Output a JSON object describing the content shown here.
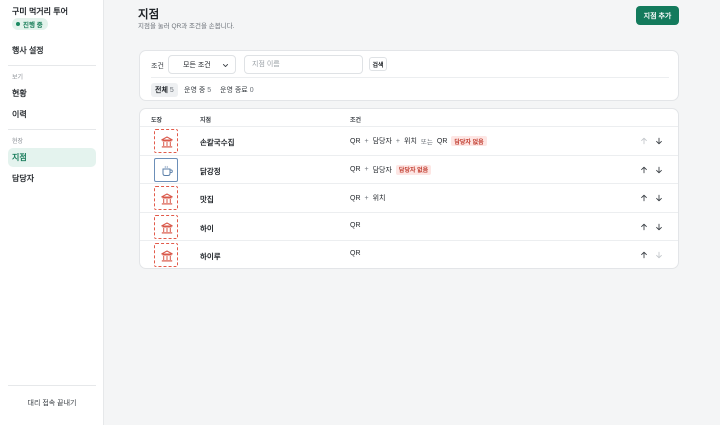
{
  "sidebar": {
    "event_name": "구미 먹거리 투어",
    "status": "진행 중",
    "settings": "행사 설정",
    "group_view": "보기",
    "status_item": "현황",
    "history_item": "이력",
    "group_field": "현장",
    "locations_item": "지점",
    "managers_item": "담당자",
    "proxy_exit": "대리 접속 끝내기",
    "accent": "#137a5c"
  },
  "header": {
    "title": "지점",
    "subtitle": "지점을 눌러 QR과 조건을 손봅니다.",
    "add_button": "지점 추가"
  },
  "filter": {
    "condition_label": "조건",
    "condition_value": "모든 조건",
    "name_placeholder": "지점 이름",
    "search_button": "검색",
    "tabs": [
      {
        "label": "전체",
        "count": "5"
      },
      {
        "label": "운영 중",
        "count": "5"
      },
      {
        "label": "운영 종료",
        "count": "0"
      }
    ]
  },
  "table": {
    "headers": {
      "stamp": "도장",
      "location": "지점",
      "condition": "조건"
    },
    "tokens": {
      "qr": "QR",
      "plus": "+",
      "manager": "담당자",
      "position": "위치",
      "or": "또는",
      "no_manager": "담당자 없음"
    },
    "rows": [
      {
        "name": "손칼국수집",
        "stamp_icon": "building-icon"
      },
      {
        "name": "닭강정",
        "stamp_icon": "cup-icon"
      },
      {
        "name": "맛집",
        "stamp_icon": "building-icon"
      },
      {
        "name": "하이",
        "stamp_icon": "building-icon"
      },
      {
        "name": "하이루",
        "stamp_icon": "building-icon"
      }
    ]
  }
}
